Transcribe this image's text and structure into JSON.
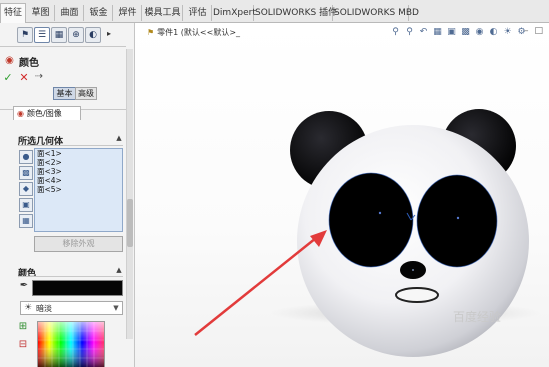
{
  "tabs": [
    {
      "label": "特征",
      "active": true
    },
    {
      "label": "草图"
    },
    {
      "label": "曲面"
    },
    {
      "label": "钣金"
    },
    {
      "label": "焊件"
    },
    {
      "label": "模具工具"
    },
    {
      "label": "评估"
    },
    {
      "label": "DimXpert"
    },
    {
      "label": "SOLIDWORKS 插件"
    },
    {
      "label": "SOLIDWORKS MBD"
    }
  ],
  "property_manager": {
    "title": "颜色",
    "mode_basic": "基本",
    "mode_advanced": "高级",
    "sub_tab": "颜色/图像",
    "selected_geometry_label": "所选几何体",
    "faces": [
      "面<1>",
      "面<2>",
      "面<3>",
      "面<4>",
      "面<5>"
    ],
    "remove_appearance": "移除外观",
    "color_label": "颜色",
    "shading": "暗淡",
    "color_value": "#050505"
  },
  "viewport": {
    "tree_item": "零件1 (默认<<默认>_",
    "watermark": "百度经验"
  },
  "colors": {
    "ui_accent": "#2f5597",
    "arrow": "#e23b3b",
    "selected_list": "#dce8f7"
  }
}
